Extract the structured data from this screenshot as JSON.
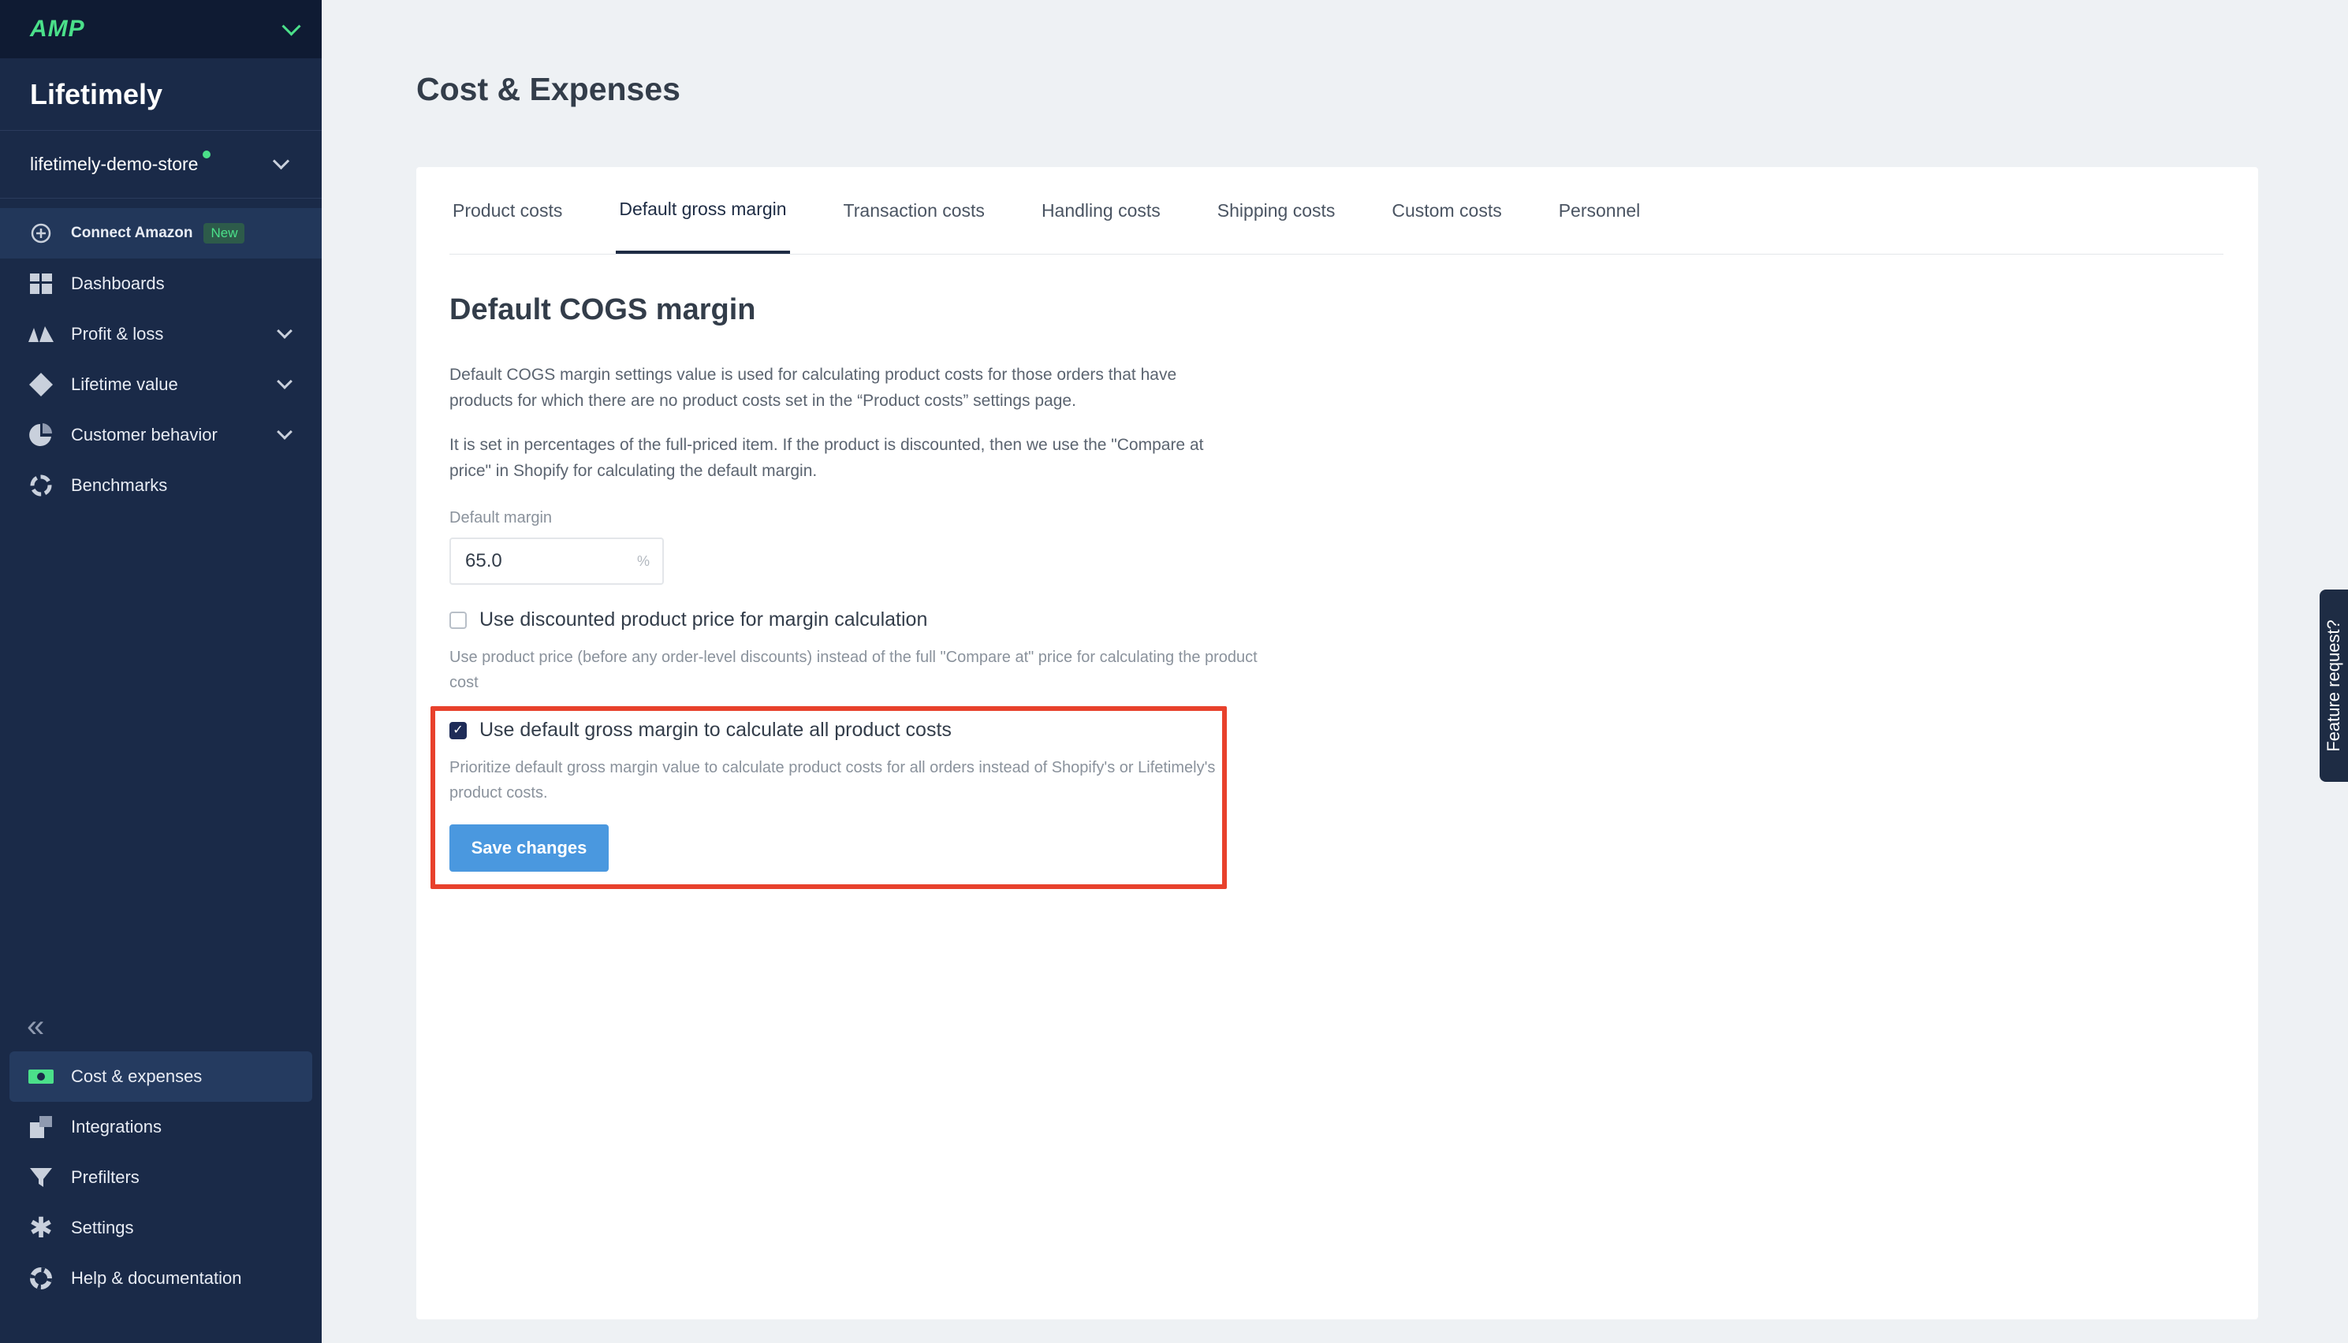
{
  "sidebar": {
    "logo": "AMP",
    "brand": "Lifetimely",
    "store": "lifetimely-demo-store",
    "items": [
      {
        "label": "Connect Amazon",
        "badge": "New"
      },
      {
        "label": "Dashboards"
      },
      {
        "label": "Profit & loss"
      },
      {
        "label": "Lifetime value"
      },
      {
        "label": "Customer behavior"
      },
      {
        "label": "Benchmarks"
      }
    ],
    "bottom_items": [
      {
        "label": "Cost & expenses"
      },
      {
        "label": "Integrations"
      },
      {
        "label": "Prefilters"
      },
      {
        "label": "Settings"
      },
      {
        "label": "Help & documentation"
      }
    ]
  },
  "page": {
    "title": "Cost & Expenses",
    "tabs": [
      "Product costs",
      "Default gross margin",
      "Transaction costs",
      "Handling costs",
      "Shipping costs",
      "Custom costs",
      "Personnel"
    ],
    "active_tab": "Default gross margin",
    "section_title": "Default COGS margin",
    "para1": "Default COGS margin settings value is used for calculating product costs for those orders that have products for which there are no product costs set in the “Product costs” settings page.",
    "para2": "It is set in percentages of the full-priced item. If the product is discounted, then we use the \"Compare at price\" in Shopify for calculating the default margin.",
    "margin_label": "Default margin",
    "margin_value": "65.0",
    "margin_unit": "%",
    "opt1_label": "Use discounted product price for margin calculation",
    "opt1_help": "Use product price (before any order-level discounts) instead of the full \"Compare at\" price for calculating the product cost",
    "opt1_checked": false,
    "opt2_label": "Use default gross margin to calculate all product costs",
    "opt2_help": "Prioritize default gross margin value to calculate product costs for all orders instead of Shopify's or Lifetimely's product costs.",
    "opt2_checked": true,
    "save_label": "Save changes",
    "feature_request": "Feature request?"
  },
  "colors": {
    "sidebar_bg": "#1a2a48",
    "accent_green": "#4be08a",
    "button_blue": "#4a98df",
    "highlight_red": "#e8412c"
  }
}
